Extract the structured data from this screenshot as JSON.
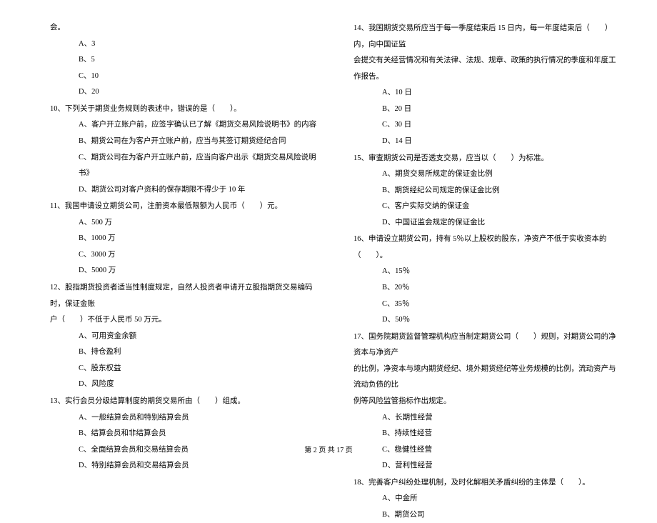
{
  "left": {
    "prefix_fragment": "会。",
    "q9_options": [
      "A、3",
      "B、5",
      "C、10",
      "D、20"
    ],
    "q10": "10、下列关于期货业务规则的表述中，错误的是（　　）。",
    "q10_options": [
      "A、客户开立账户前，应签字确认已了解《期货交易风险说明书》的内容",
      "B、期货公司在为客户开立账户前，应当与其签订期货经纪合同",
      "C、期货公司在为客户开立账户前，应当向客户出示《期货交易风险说明书》",
      "D、期货公司对客户资料的保存期限不得少于 10 年"
    ],
    "q11": "11、我国申请设立期货公司，注册资本最低限额为人民币（　　）元。",
    "q11_options": [
      "A、500 万",
      "B、1000 万",
      "C、3000 万",
      "D、5000 万"
    ],
    "q12_line1": "12、股指期货投资者适当性制度规定，自然人投资者申请开立股指期货交易编码时，保证金账",
    "q12_line2": "户（　　）不低于人民币 50 万元。",
    "q12_options": [
      "A、可用资金余额",
      "B、持仓盈利",
      "C、股东权益",
      "D、风险度"
    ],
    "q13": "13、实行会员分级结算制度的期货交易所由（　　）组成。",
    "q13_options": [
      "A、一般结算会员和特别结算会员",
      "B、结算会员和非结算会员",
      "C、全面结算会员和交易结算会员",
      "D、特别结算会员和交易结算会员"
    ]
  },
  "right": {
    "q14_line1": "14、我国期货交易所应当于每一季度结束后 15 日内，每一年度结束后（　　）内，向中国证监",
    "q14_line2": "会提交有关经营情况和有关法律、法规、规章、政策的执行情况的季度和年度工作报告。",
    "q14_options": [
      "A、10 日",
      "B、20 日",
      "C、30 日",
      "D、14 日"
    ],
    "q15": "15、审查期货公司是否透支交易，应当以（　　）为标准。",
    "q15_options": [
      "A、期货交易所规定的保证金比例",
      "B、期货经纪公司规定的保证金比例",
      "C、客户实际交纳的保证金",
      "D、中国证监会规定的保证金比"
    ],
    "q16": "16、申请设立期货公司，持有 5％以上股权的股东，净资产不低于实收资本的（　　）。",
    "q16_options": [
      "A、15％",
      "B、20％",
      "C、35％",
      "D、50％"
    ],
    "q17_line1": "17、国务院期货监督管理机构应当制定期货公司（　　）规则，对期货公司的净资本与净资产",
    "q17_line2": "的比例，净资本与境内期货经纪、境外期货经纪等业务规模的比例，流动资产与流动负债的比",
    "q17_line3": "例等风险监管指标作出规定。",
    "q17_options": [
      "A、长期性经营",
      "B、持续性经营",
      "C、稳健性经营",
      "D、营利性经营"
    ],
    "q18": "18、完善客户纠纷处理机制，及时化解相关矛盾纠纷的主体是（　　）。",
    "q18_options": [
      "A、中金所",
      "B、期货公司"
    ]
  },
  "footer": "第 2 页 共 17 页"
}
